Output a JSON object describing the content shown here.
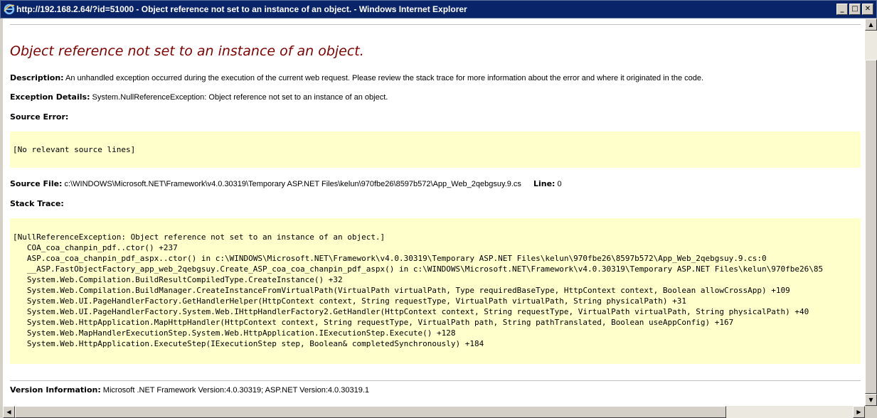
{
  "window": {
    "title": "http://192.168.2.64/?id=51000 - Object reference not set to an instance of an object. - Windows Internet Explorer",
    "minimize": "_",
    "maximize": "□",
    "close": "✕"
  },
  "page": {
    "heading": "Object reference not set to an instance of an object.",
    "description_label": "Description:",
    "description_text": "An unhandled exception occurred during the execution of the current web request. Please review the stack trace for more information about the error and where it originated in the code.",
    "exception_label": "Exception Details:",
    "exception_text": "System.NullReferenceException: Object reference not set to an instance of an object.",
    "source_error_label": "Source Error:",
    "source_error_text": "[No relevant source lines]",
    "source_file_label": "Source File:",
    "source_file_text": "c:\\WINDOWS\\Microsoft.NET\\Framework\\v4.0.30319\\Temporary ASP.NET Files\\kelun\\970fbe26\\8597b572\\App_Web_2qebgsuy.9.cs",
    "line_label": "Line:",
    "line_text": "0",
    "stack_trace_label": "Stack Trace:",
    "stack_trace": "[NullReferenceException: Object reference not set to an instance of an object.]\n   COA_coa_chanpin_pdf..ctor() +237\n   ASP.coa_coa_chanpin_pdf_aspx..ctor() in c:\\WINDOWS\\Microsoft.NET\\Framework\\v4.0.30319\\Temporary ASP.NET Files\\kelun\\970fbe26\\8597b572\\App_Web_2qebgsuy.9.cs:0\n   __ASP.FastObjectFactory_app_web_2qebgsuy.Create_ASP_coa_coa_chanpin_pdf_aspx() in c:\\WINDOWS\\Microsoft.NET\\Framework\\v4.0.30319\\Temporary ASP.NET Files\\kelun\\970fbe26\\85\n   System.Web.Compilation.BuildResultCompiledType.CreateInstance() +32\n   System.Web.Compilation.BuildManager.CreateInstanceFromVirtualPath(VirtualPath virtualPath, Type requiredBaseType, HttpContext context, Boolean allowCrossApp) +109\n   System.Web.UI.PageHandlerFactory.GetHandlerHelper(HttpContext context, String requestType, VirtualPath virtualPath, String physicalPath) +31\n   System.Web.UI.PageHandlerFactory.System.Web.IHttpHandlerFactory2.GetHandler(HttpContext context, String requestType, VirtualPath virtualPath, String physicalPath) +40\n   System.Web.HttpApplication.MapHttpHandler(HttpContext context, String requestType, VirtualPath path, String pathTranslated, Boolean useAppConfig) +167\n   System.Web.MapHandlerExecutionStep.System.Web.HttpApplication.IExecutionStep.Execute() +128\n   System.Web.HttpApplication.ExecuteStep(IExecutionStep step, Boolean& completedSynchronously) +184",
    "version_label": "Version Information:",
    "version_text": "Microsoft .NET Framework Version:4.0.30319; ASP.NET Version:4.0.30319.1"
  },
  "colors": {
    "heading": "#800000",
    "code_background": "#ffffcc",
    "titlebar": "#0a246a"
  }
}
